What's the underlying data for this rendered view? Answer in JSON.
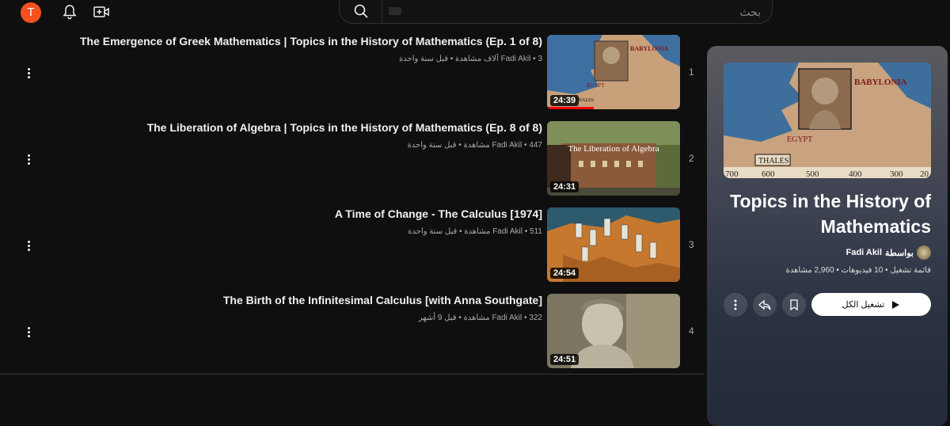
{
  "header": {
    "avatar_letter": "T",
    "icons": [
      "bell-icon",
      "create-video-icon",
      "search-icon",
      "keyboard-icon"
    ],
    "search_placeholder": "بحث"
  },
  "videos": [
    {
      "index": "1",
      "title": "The Emergence of Greek Mathematics | Topics in the History of Mathematics (Ep. 1 of 8)",
      "channel": "Fadi Akil",
      "meta": "3 آلاف مشاهدة • قبل سنة واحدة",
      "duration": "24:39",
      "thumb_text": [
        "BABYLONIA",
        "EGYPT",
        "THALES"
      ]
    },
    {
      "index": "2",
      "title": "The Liberation of Algebra | Topics in the History of Mathematics (Ep. 8 of 8)",
      "channel": "Fadi Akil",
      "meta": "447 مشاهدة • قبل سنة واحدة",
      "duration": "24:31",
      "thumb_text": [
        "The Liberation of Algebra"
      ]
    },
    {
      "index": "3",
      "title": "A Time of Change - The Calculus [1974]",
      "channel": "Fadi Akil",
      "meta": "511 مشاهدة • قبل سنة واحدة",
      "duration": "24:54",
      "thumb_text": []
    },
    {
      "index": "4",
      "title": "The Birth of the Infinitesimal Calculus [with Anna Southgate]",
      "channel": "Fadi Akil",
      "meta": "322 مشاهدة • قبل 9 أشهر",
      "duration": "24:51",
      "thumb_text": []
    }
  ],
  "playlist": {
    "title": "Topics in the History of Mathematics",
    "owner_prefix": "بواسطة",
    "owner": "Fadi Akil",
    "meta": "قائمة تشغيل • 10 فيديوهات • 2,960 مشاهدة",
    "play_all": "تشغيل الكل",
    "thumb_text": [
      "BABYLONIA",
      "EGYPT",
      "THALES",
      "700",
      "600",
      "500",
      "400",
      "300",
      "20"
    ]
  },
  "colors": {
    "background": "#0f0f0f",
    "avatar": "#f4511e",
    "progress": "#ff0000"
  }
}
